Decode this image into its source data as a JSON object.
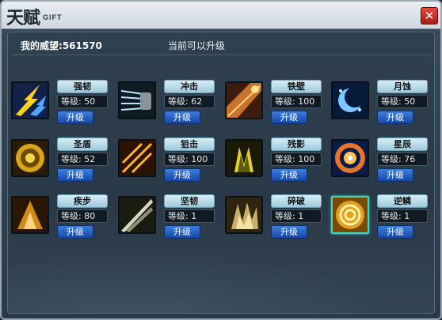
{
  "window": {
    "title_cn": "天赋",
    "title_en": "GIFT",
    "close_icon": "close-icon"
  },
  "header": {
    "reputation_label": "我的威望:",
    "reputation_value": "561570",
    "status_text": "当前可以升级"
  },
  "labels": {
    "level": "等级:",
    "upgrade": "升级"
  },
  "skills": [
    {
      "name": "强韧",
      "level": "50",
      "icon": "blue-lightning-icon"
    },
    {
      "name": "冲击",
      "level": "62",
      "icon": "fist-impact-icon"
    },
    {
      "name": "铁壁",
      "level": "100",
      "icon": "iron-wall-icon"
    },
    {
      "name": "月蚀",
      "level": "50",
      "icon": "moon-eclipse-icon"
    },
    {
      "name": "圣盾",
      "level": "52",
      "icon": "holy-shield-icon"
    },
    {
      "name": "狙击",
      "level": "100",
      "icon": "snipe-icon"
    },
    {
      "name": "残影",
      "level": "100",
      "icon": "shadow-icon"
    },
    {
      "name": "星辰",
      "level": "76",
      "icon": "star-swirl-icon"
    },
    {
      "name": "疾步",
      "level": "80",
      "icon": "swift-step-icon"
    },
    {
      "name": "坚韧",
      "level": "1",
      "icon": "blade-icon"
    },
    {
      "name": "碎破",
      "level": "1",
      "icon": "shatter-icon"
    },
    {
      "name": "逆鳞",
      "level": "1",
      "icon": "golden-vortex-icon"
    }
  ]
}
